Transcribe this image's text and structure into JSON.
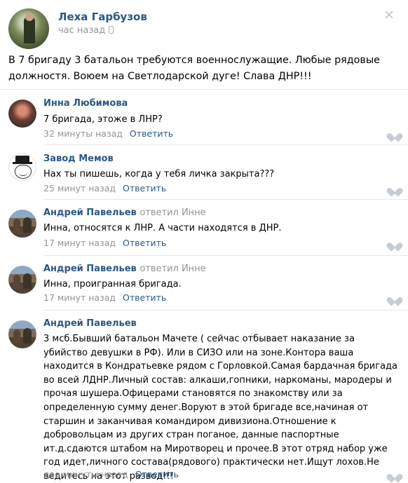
{
  "post": {
    "author": "Леха Гарбузов",
    "time": "час назад",
    "text": "В 7 бригаду 3 батальон требуются военнослужащие. Любые рядовые должностя. Воюем на Светлодарской дуге! Слава ДНР!!!"
  },
  "comments": [
    {
      "author": "Инна Любимова",
      "replied_to": "",
      "text": "7 бригада, этоже в ЛНР?",
      "time": "32 минуты назад",
      "reply_label": "Ответить"
    },
    {
      "author": "Завод Мемов",
      "replied_to": "",
      "text": "Нах ты пишешь, когда у тебя личка закрыта???",
      "time": "25 минут назад",
      "reply_label": "Ответить"
    },
    {
      "author": "Андрей Павельев",
      "replied_to": "ответил Инне",
      "text": "Инна, относятся к ЛНР. А части находятся в ДНР.",
      "time": "17 минут назад",
      "reply_label": "Ответить"
    },
    {
      "author": "Андрей Павельев",
      "replied_to": "ответил Инне",
      "text": "Инна, проигранная бригада.",
      "time": "17 минут назад",
      "reply_label": "Ответить"
    },
    {
      "author": "Андрей Павельев",
      "replied_to": "",
      "text": "3 мсб.Бывший батальон Мачете ( сейчас отбывает наказание за убийство девушки в РФ). Или в СИЗО или на зоне.Контора ваша находится в Кондратьевке рядом с Горловкой.Самая бардачная бригада во всей ЛДНР.Личный состав: алкаши,гопники, наркоманы, мародеры и прочая шушера.Офицерами становятся по знакомству или за определенную сумму денег.Воруют в этой бригаде все,начиная от старшин и заканчивая командиром дивизиона.Отношение к добровольцам из других стран поганое, данные паспортные ит.д.сдаются штабом на Миротворец и прочее.В этот отряд набор уже год идет,личного состава(рядового) практически нет.Ищут лохов.Не ведитесь на этот развод!!!",
      "time": "две минуты назад",
      "reply_label": "Ответить"
    }
  ]
}
